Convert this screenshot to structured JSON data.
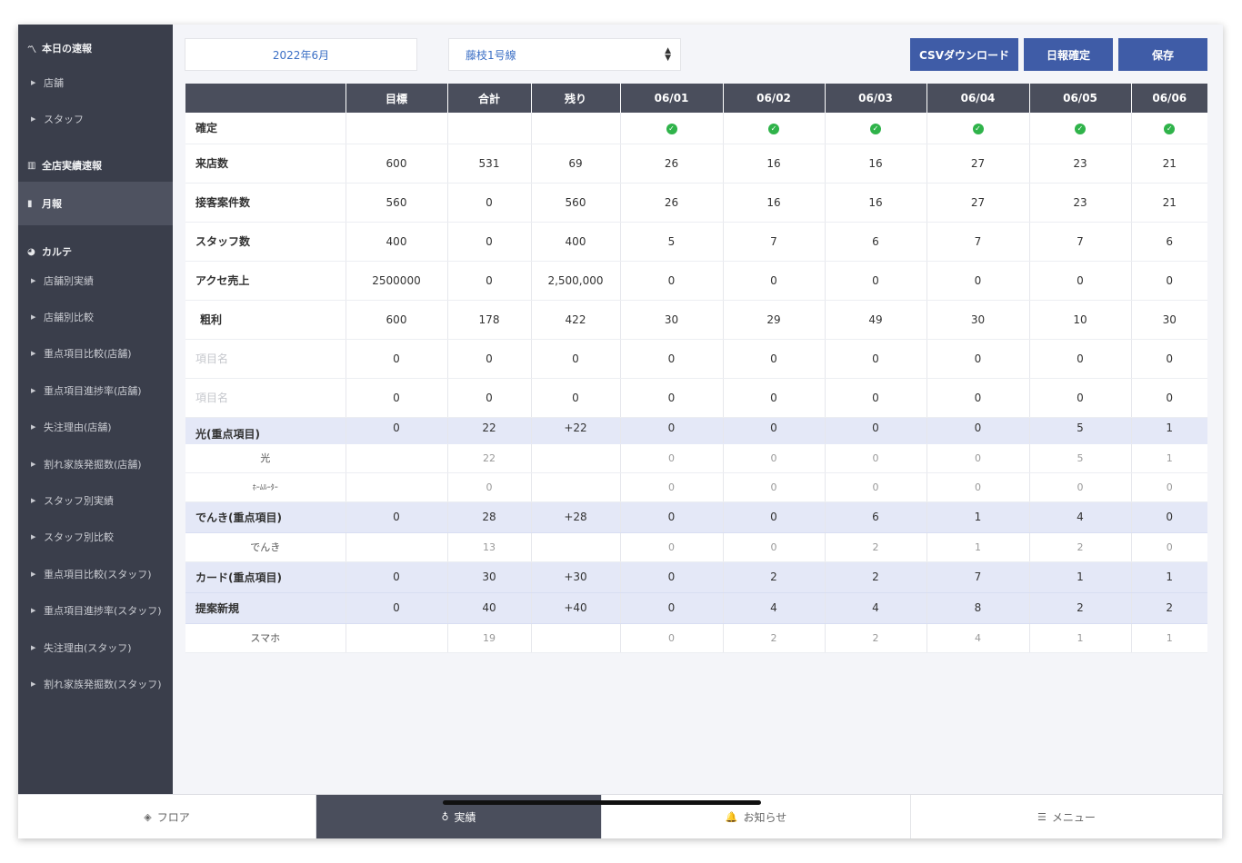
{
  "sidebar": {
    "items": [
      {
        "label": "本日の速報",
        "type": "main",
        "icon": "trend-icon",
        "glyph": "〽"
      },
      {
        "label": "店舗",
        "type": "sub"
      },
      {
        "label": "スタッフ",
        "type": "sub"
      },
      {
        "label": "全店実績速報",
        "type": "main",
        "icon": "bar-chart-icon",
        "glyph": "▥"
      },
      {
        "label": "月報",
        "type": "main",
        "icon": "document-icon",
        "glyph": "▮",
        "active": true
      },
      {
        "label": "カルテ",
        "type": "main",
        "icon": "pie-chart-icon",
        "glyph": "◕"
      },
      {
        "label": "店舗別実績",
        "type": "sub"
      },
      {
        "label": "店舗別比較",
        "type": "sub"
      },
      {
        "label": "重点項目比較(店舗)",
        "type": "sub"
      },
      {
        "label": "重点項目進捗率(店舗)",
        "type": "sub"
      },
      {
        "label": "失注理由(店舗)",
        "type": "sub"
      },
      {
        "label": "割れ家族発掘数(店舗)",
        "type": "sub"
      },
      {
        "label": "スタッフ別実績",
        "type": "sub"
      },
      {
        "label": "スタッフ別比較",
        "type": "sub"
      },
      {
        "label": "重点項目比較(スタッフ)",
        "type": "sub"
      },
      {
        "label": "重点項目進捗率(スタッフ)",
        "type": "sub"
      },
      {
        "label": "失注理由(スタッフ)",
        "type": "sub"
      },
      {
        "label": "割れ家族発掘数(スタッフ)",
        "type": "sub"
      }
    ]
  },
  "controls": {
    "month": "2022年6月",
    "line": "藤枝1号線",
    "csv_label": "CSVダウンロード",
    "confirm_label": "日報確定",
    "save_label": "保存"
  },
  "table": {
    "headers": [
      "",
      "目標",
      "合計",
      "残り",
      "06/01",
      "06/02",
      "06/03",
      "06/04",
      "06/05",
      "06/06"
    ],
    "rows": [
      {
        "kind": "confirm",
        "label": "確定",
        "cells": [
          "",
          "",
          "",
          "✓",
          "✓",
          "✓",
          "✓",
          "✓",
          "✓"
        ]
      },
      {
        "kind": "main",
        "label": "来店数",
        "cells": [
          "600",
          "531",
          "69",
          "26",
          "16",
          "16",
          "27",
          "23",
          "21"
        ]
      },
      {
        "kind": "main",
        "label": "接客案件数",
        "cells": [
          "560",
          "0",
          "560",
          "26",
          "16",
          "16",
          "27",
          "23",
          "21"
        ]
      },
      {
        "kind": "main",
        "label": "スタッフ数",
        "cells": [
          "400",
          "0",
          "400",
          "5",
          "7",
          "6",
          "7",
          "7",
          "6"
        ]
      },
      {
        "kind": "main",
        "label": "アクセ売上",
        "cells": [
          "2500000",
          "0",
          "2,500,000",
          "0",
          "0",
          "0",
          "0",
          "0",
          "0"
        ]
      },
      {
        "kind": "main",
        "label": "粗利",
        "indent": true,
        "cells": [
          "600",
          "178",
          "422",
          "30",
          "29",
          "49",
          "30",
          "10",
          "30"
        ]
      },
      {
        "kind": "main",
        "label": "項目名",
        "gray": true,
        "cells": [
          "0",
          "0",
          "0",
          "0",
          "0",
          "0",
          "0",
          "0",
          "0"
        ]
      },
      {
        "kind": "main",
        "label": "項目名",
        "gray": true,
        "cells": [
          "0",
          "0",
          "0",
          "0",
          "0",
          "0",
          "0",
          "0",
          "0"
        ]
      },
      {
        "kind": "sec",
        "label": "光(重点項目)",
        "cells": [
          "0",
          "22",
          "+22",
          "0",
          "0",
          "0",
          "0",
          "5",
          "1"
        ]
      },
      {
        "kind": "sub",
        "label": "光",
        "cells": [
          "",
          "22",
          "",
          "0",
          "0",
          "0",
          "0",
          "5",
          "1"
        ]
      },
      {
        "kind": "sub",
        "small": true,
        "label": "ﾎｰﾑﾙｰﾀｰ",
        "cells": [
          "",
          "0",
          "",
          "0",
          "0",
          "0",
          "0",
          "0",
          "0"
        ]
      },
      {
        "kind": "sec2",
        "label": "でんき(重点項目)",
        "cells": [
          "0",
          "28",
          "+28",
          "0",
          "0",
          "6",
          "1",
          "4",
          "0"
        ]
      },
      {
        "kind": "sub",
        "label": "でんき",
        "cells": [
          "",
          "13",
          "",
          "0",
          "0",
          "2",
          "1",
          "2",
          "0"
        ]
      },
      {
        "kind": "sec2",
        "label": "カード(重点項目)",
        "cells": [
          "0",
          "30",
          "+30",
          "0",
          "2",
          "2",
          "7",
          "1",
          "1"
        ]
      },
      {
        "kind": "sec2",
        "label": "提案新規",
        "cells": [
          "0",
          "40",
          "+40",
          "0",
          "4",
          "4",
          "8",
          "2",
          "2"
        ]
      },
      {
        "kind": "sub",
        "label": "スマホ",
        "cells": [
          "",
          "19",
          "",
          "0",
          "2",
          "2",
          "4",
          "1",
          "1"
        ]
      }
    ]
  },
  "tabbar": {
    "tabs": [
      {
        "label": "フロア",
        "icon": "layers-icon",
        "glyph": "◈"
      },
      {
        "label": "実績",
        "icon": "award-icon",
        "glyph": "♁",
        "active": true
      },
      {
        "label": "お知らせ",
        "icon": "bell-icon",
        "glyph": "🔔"
      },
      {
        "label": "メニュー",
        "icon": "list-icon",
        "glyph": "☰"
      }
    ]
  },
  "colors": {
    "sidebar": "#3a3e4b",
    "accent": "#3f5ca7",
    "header": "#4a4e5c",
    "section_row": "#e4e8f7",
    "check": "#2fb34a"
  }
}
